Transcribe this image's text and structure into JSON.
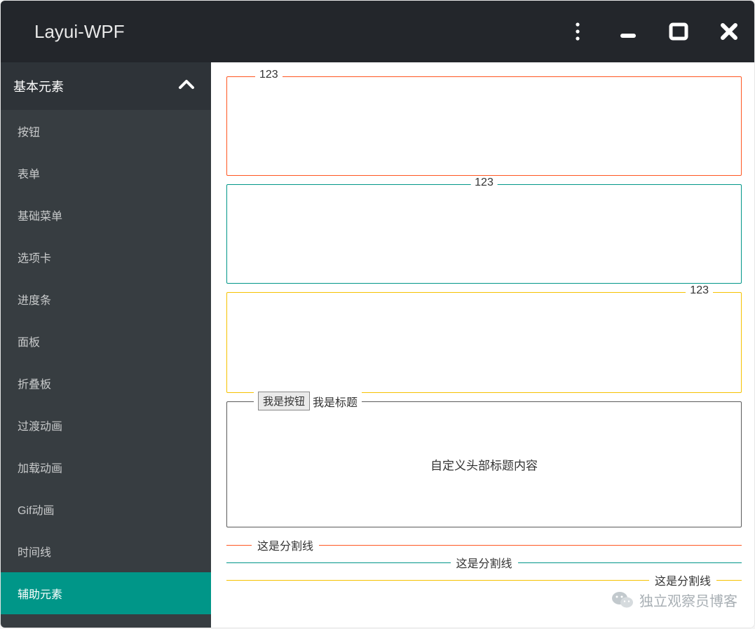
{
  "titlebar": {
    "title": "Layui-WPF"
  },
  "sidebar": {
    "group": "基本元素",
    "items": [
      {
        "label": "按钮"
      },
      {
        "label": "表单"
      },
      {
        "label": "基础菜单"
      },
      {
        "label": "选项卡"
      },
      {
        "label": "进度条"
      },
      {
        "label": "面板"
      },
      {
        "label": "折叠板"
      },
      {
        "label": "过渡动画"
      },
      {
        "label": "加载动画"
      },
      {
        "label": "Gif动画"
      },
      {
        "label": "时间线"
      },
      {
        "label": "辅助元素",
        "active": true
      }
    ]
  },
  "fieldsets": {
    "orange": {
      "legend": "123"
    },
    "green": {
      "legend": "123"
    },
    "yellow": {
      "legend": "123"
    },
    "gray": {
      "button": "我是按钮",
      "title": "我是标题",
      "center": "自定义头部标题内容"
    }
  },
  "dividers": {
    "orange": "这是分割线",
    "green": "这是分割线",
    "yellow": "这是分割线"
  },
  "watermark": {
    "text": "独立观察员博客"
  }
}
